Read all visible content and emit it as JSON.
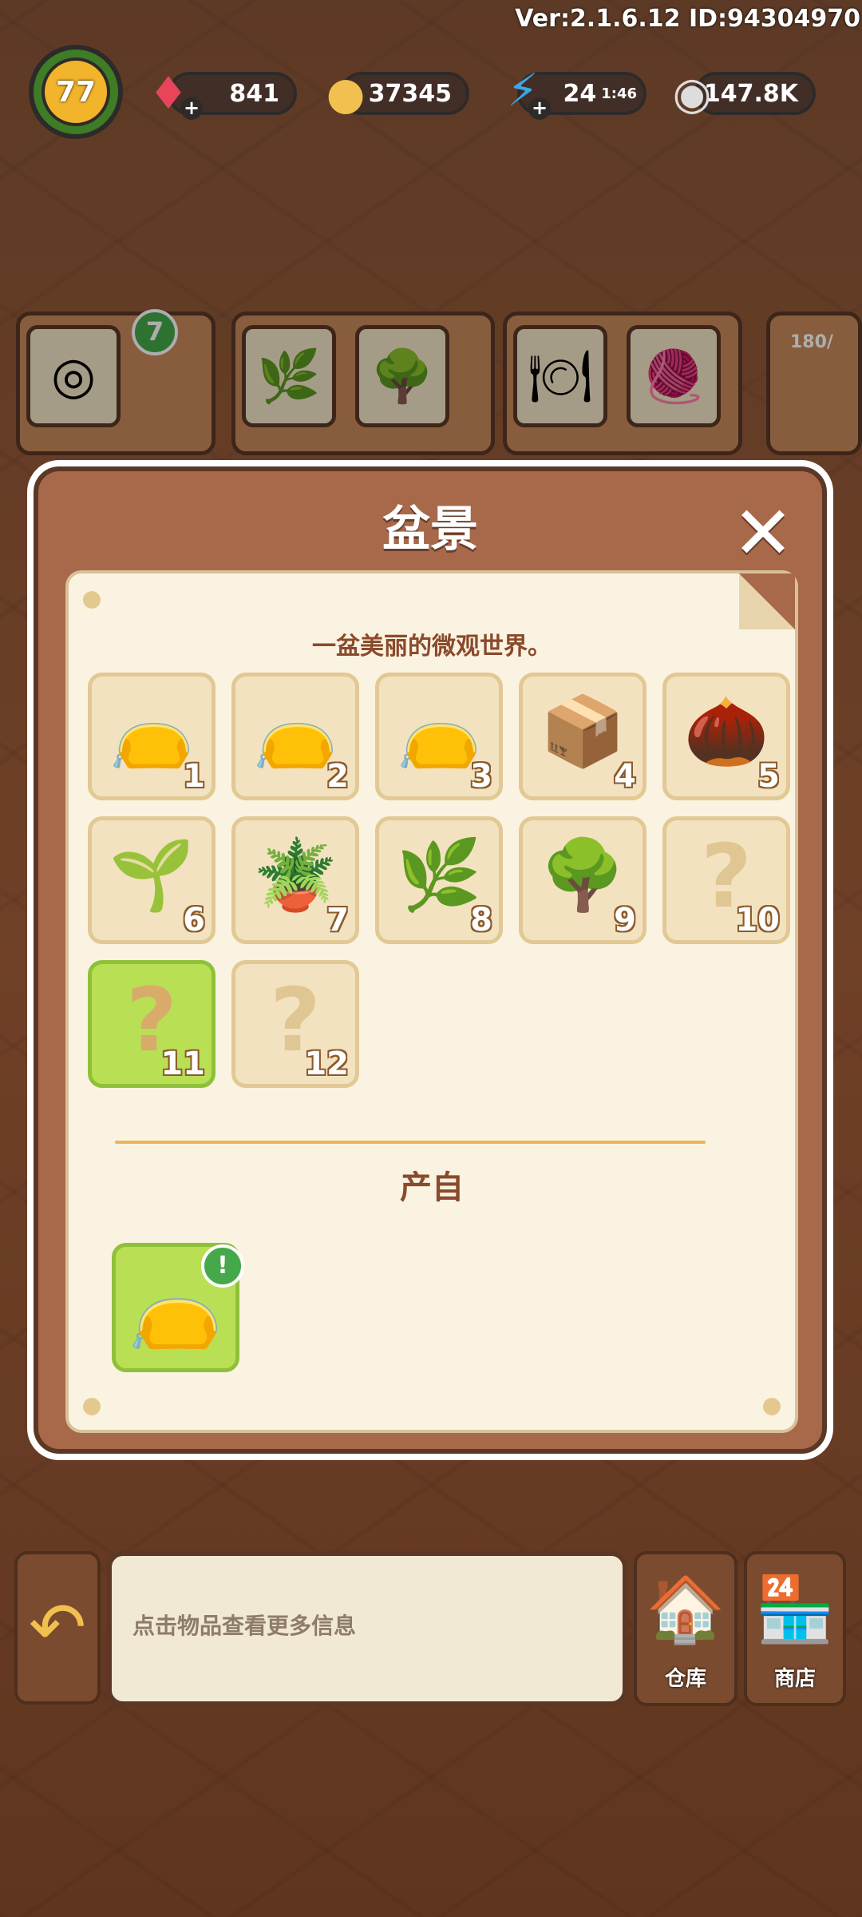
{
  "hud": {
    "version": "Ver:2.1.6.12 ID:94304970",
    "level": "77",
    "gems": "841",
    "coins": "37345",
    "energy": "24",
    "energy_timer": "1:46",
    "seeds": "147.8K",
    "shelf_badge": "7",
    "storage_partial": "180/"
  },
  "icons": {
    "gem": "gem-icon",
    "coin": "coin-icon",
    "energy": "lightning-icon",
    "seed": "seed-icon",
    "close": "close-icon",
    "back": "back-arrow-icon",
    "warehouse": "warehouse-icon",
    "shop": "shop-icon"
  },
  "modal": {
    "title": "盆景",
    "description": "一盆美丽的微观世界。",
    "items": [
      {
        "num": "1",
        "glyph": "👝",
        "unknown": false
      },
      {
        "num": "2",
        "glyph": "👝",
        "unknown": false
      },
      {
        "num": "3",
        "glyph": "👝",
        "unknown": false
      },
      {
        "num": "4",
        "glyph": "📦",
        "unknown": false
      },
      {
        "num": "5",
        "glyph": "🌰",
        "unknown": false
      },
      {
        "num": "6",
        "glyph": "🌱",
        "unknown": false
      },
      {
        "num": "7",
        "glyph": "🪴",
        "unknown": false
      },
      {
        "num": "8",
        "glyph": "🌿",
        "unknown": false
      },
      {
        "num": "9",
        "glyph": "🌳",
        "unknown": false
      },
      {
        "num": "10",
        "glyph": "?",
        "unknown": true
      },
      {
        "num": "11",
        "glyph": "?",
        "unknown": true,
        "highlight": true
      },
      {
        "num": "12",
        "glyph": "?",
        "unknown": true
      }
    ],
    "produced_from_label": "产自",
    "source_alert": "!"
  },
  "bottom": {
    "info_text": "点击物品查看更多信息",
    "warehouse_label": "仓库",
    "shop_label": "商店"
  }
}
